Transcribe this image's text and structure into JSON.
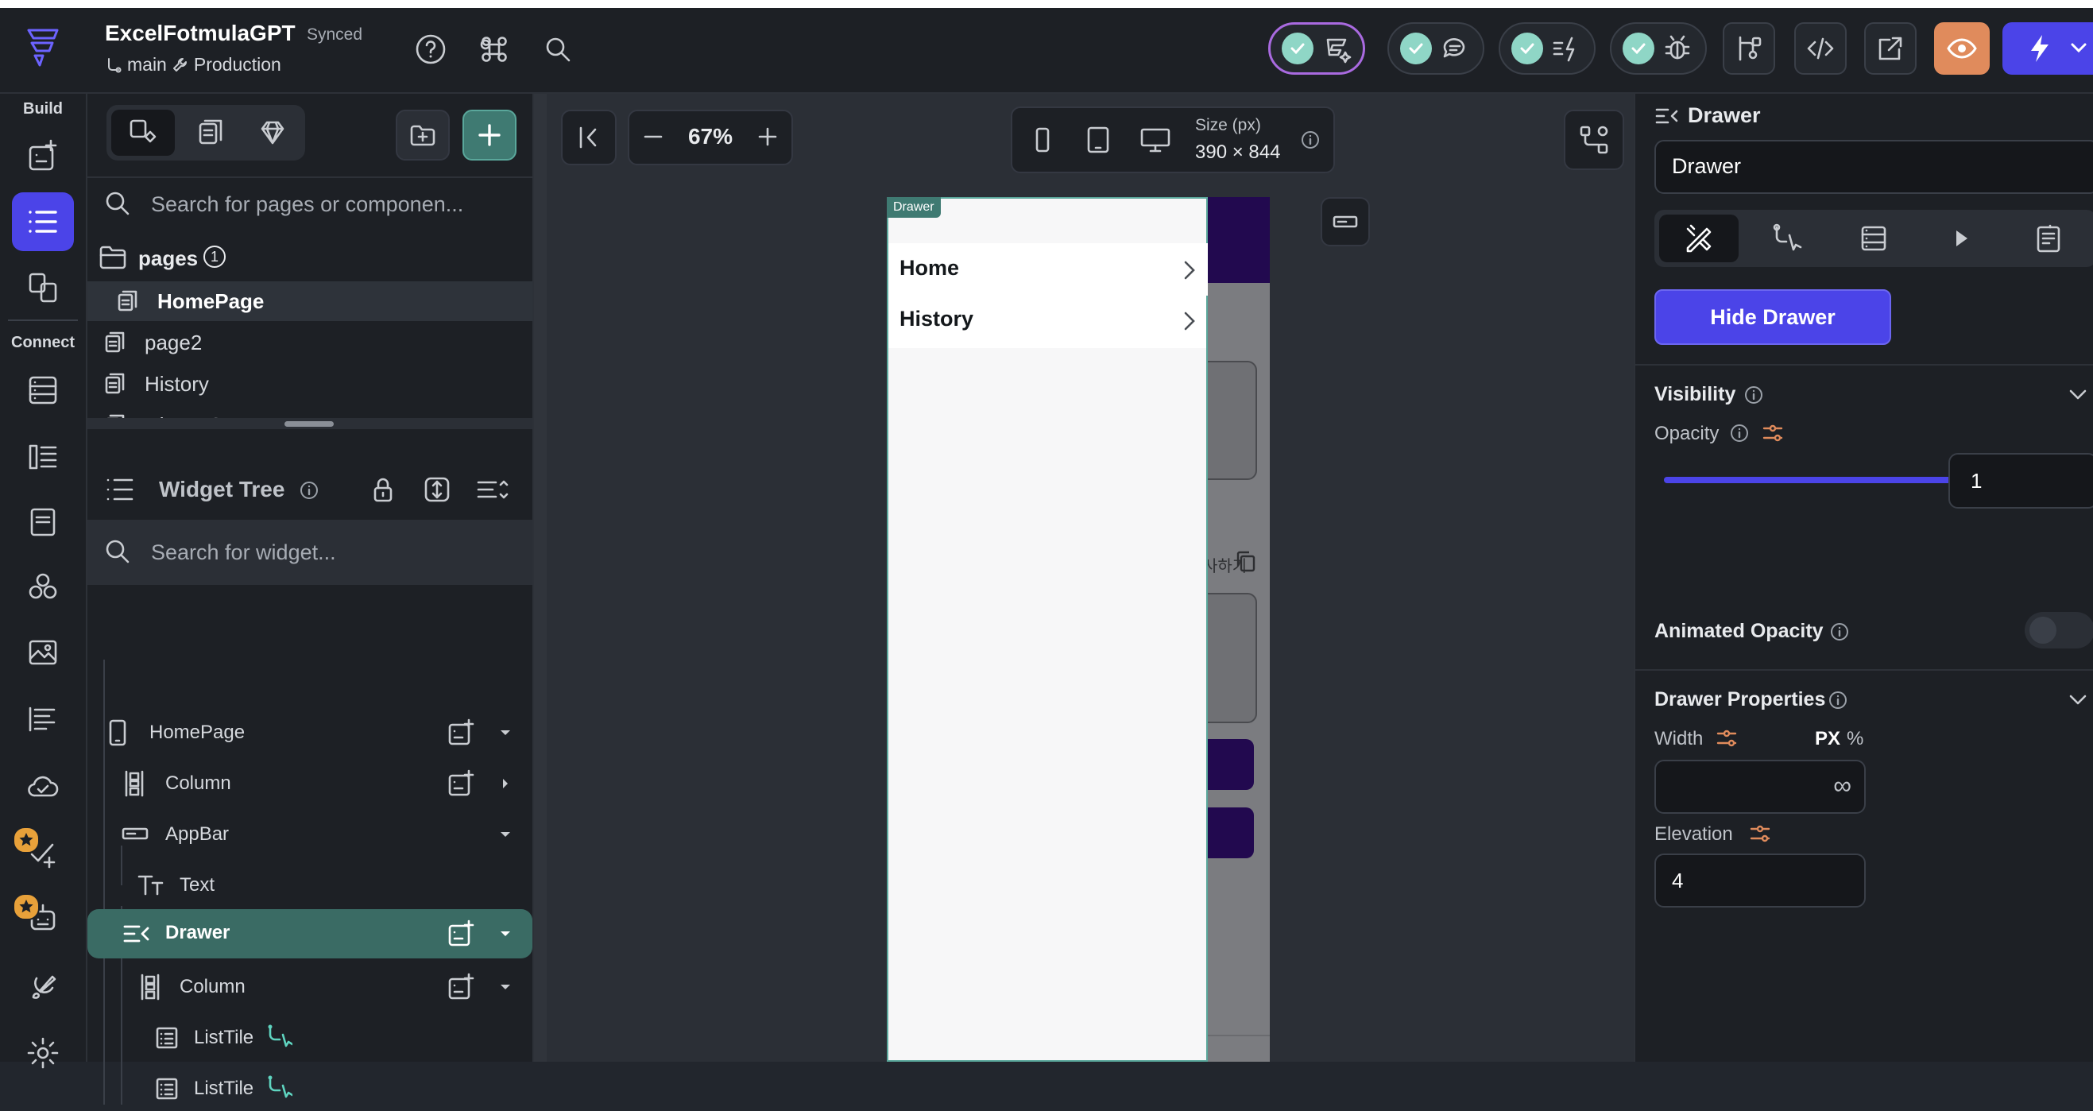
{
  "app": {
    "project_name": "ExcelFotmulaGPT",
    "sync_status": "Synced",
    "branch": "main",
    "environment": "Production"
  },
  "rail": {
    "build_label": "Build",
    "connect_label": "Connect"
  },
  "pages_panel": {
    "search_placeholder": "Search for pages or componen...",
    "folder_label": "pages",
    "folder_count": "1",
    "items": [
      "HomePage",
      "page2",
      "History",
      "HistoryS"
    ]
  },
  "widget_tree": {
    "title": "Widget Tree",
    "search_placeholder": "Search for widget...",
    "nodes": [
      "HomePage",
      "Column",
      "AppBar",
      "Text",
      "Drawer",
      "Column",
      "ListTile",
      "ListTile"
    ]
  },
  "canvas": {
    "zoom": "67%",
    "size_label": "Size (px)",
    "size_value": "390 × 844",
    "drawer_tag": "Drawer",
    "drawer_items": [
      "Home",
      "History"
    ],
    "bg_text": "사하기"
  },
  "properties": {
    "widget_type": "Drawer",
    "name_value": "Drawer",
    "hide_button": "Hide Drawer",
    "visibility_title": "Visibility",
    "opacity_label": "Opacity",
    "opacity_value": "1",
    "opacity_level": 1.0,
    "animated_opacity_label": "Animated Opacity",
    "drawer_props_title": "Drawer Properties",
    "width_label": "Width",
    "unit_px": "PX",
    "unit_pct": "%",
    "width_value": "∞",
    "elevation_label": "Elevation",
    "elevation_value": "4"
  },
  "colors": {
    "accent": "#4b44e8",
    "teal": "#3f7a72",
    "drawer_bar": "#22094f",
    "check": "#8fd6c6",
    "warning": "#e8a13a"
  }
}
